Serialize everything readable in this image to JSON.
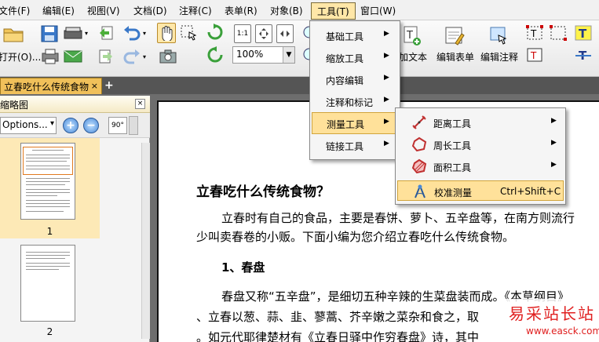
{
  "menubar": {
    "items": [
      "文件(F)",
      "编辑(E)",
      "视图(V)",
      "文档(D)",
      "注释(C)",
      "表单(R)",
      "对象(B)",
      "工具(T)",
      "窗口(W)"
    ]
  },
  "toolbar": {
    "open_label": "打开(O)...",
    "zoom_value": "100%",
    "add_text_label": "加文本",
    "edit_form_label": "编辑表单",
    "edit_annot_label": "编辑注释",
    "actual_size_label": "1:1"
  },
  "tabs": {
    "doc_tab": "立春吃什么传统食物",
    "close": "×",
    "add": "+"
  },
  "panel": {
    "title": "缩略图",
    "close": "×",
    "options_label": "Options...",
    "options_arrow": "▾",
    "zoom_in": "+",
    "zoom_out": "−",
    "rotate_label": "90°",
    "thumb_labels": [
      "1",
      "2"
    ]
  },
  "tools_menu": {
    "items": [
      {
        "label": "基础工具",
        "arrow": "▶"
      },
      {
        "label": "缩放工具",
        "arrow": "▶"
      },
      {
        "label": "内容编辑",
        "arrow": "▶"
      },
      {
        "label": "注释和标记",
        "arrow": "▶"
      },
      {
        "label": "测量工具",
        "arrow": "▶"
      },
      {
        "label": "链接工具",
        "arrow": "▶"
      }
    ]
  },
  "measure_menu": {
    "items": [
      {
        "label": "距离工具",
        "arrow": "▶",
        "icon": "distance-icon"
      },
      {
        "label": "周长工具",
        "arrow": "▶",
        "icon": "perimeter-icon"
      },
      {
        "label": "面积工具",
        "arrow": "▶",
        "icon": "area-icon"
      },
      {
        "label": "校准测量",
        "shortcut": "Ctrl+Shift+C",
        "icon": "calibrate-icon"
      }
    ]
  },
  "document": {
    "title": "立春吃什么传统食物？",
    "para1_line1": "立春时有自己的食品，主要是春饼、萝卜、五辛盘等，在南方则流行",
    "para1_line2": "少叫卖春卷的小贩。下面小编为您介绍立春吃什么传统食物。",
    "heading1": "1、春盘",
    "para2_line1": "春盘又称“五辛盘”，是细切五种辛辣的生菜盘装而成。《本草纲目》",
    "para2_line2": "、立春以葱、蒜、韭、蓼蒿、芥辛嫩之菜杂和食之，取",
    "para2_line3": "。如元代耶律楚材有《立春日驿中作穷春盘》诗，其中"
  },
  "watermark": {
    "main": "易采站长站",
    "sub": "www.easck.com"
  },
  "colors": {
    "menu_active": "#ffe7a8",
    "tab_active": "#f0c05a",
    "highlight": "#ffe19a",
    "watermark": "#e02020"
  }
}
